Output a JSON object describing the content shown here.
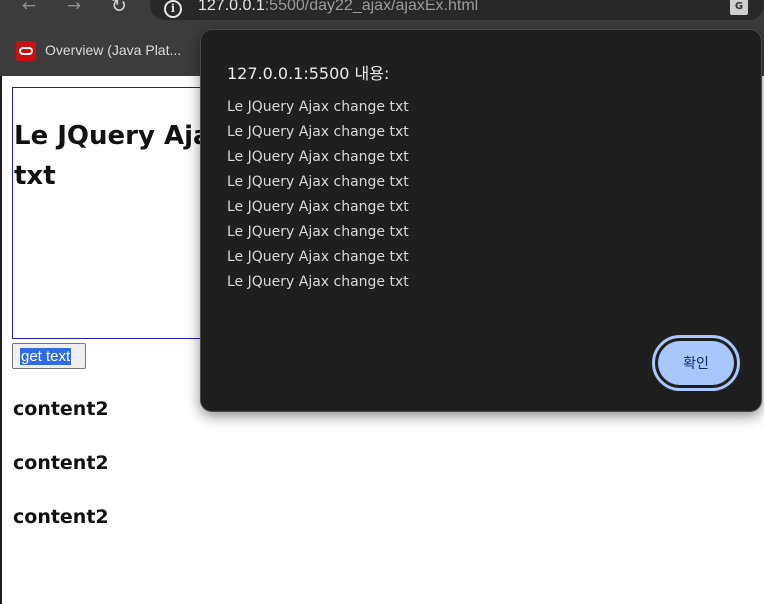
{
  "browser": {
    "back_icon": "←",
    "forward_icon": "→",
    "reload_icon": "↻",
    "url_host": "127.0.0.1",
    "url_rest": ":5500/day22_ajax/ajaxEx.html",
    "info_icon": "i",
    "translate_icon": "G",
    "bookmark_label": "Overview (Java Plat..."
  },
  "page": {
    "box_heading": "Le JQuery Ajax change txt",
    "button_label": "get text",
    "content_items": [
      "content2",
      "content2",
      "content2"
    ]
  },
  "dialog": {
    "title": "127.0.0.1:5500 내용:",
    "lines": [
      "Le JQuery Ajax change txt",
      "Le JQuery Ajax change txt",
      "Le JQuery Ajax change txt",
      "Le JQuery Ajax change txt",
      "Le JQuery Ajax change txt",
      "Le JQuery Ajax change txt",
      "Le JQuery Ajax change txt",
      "Le JQuery Ajax change txt"
    ],
    "ok_label": "확인"
  }
}
